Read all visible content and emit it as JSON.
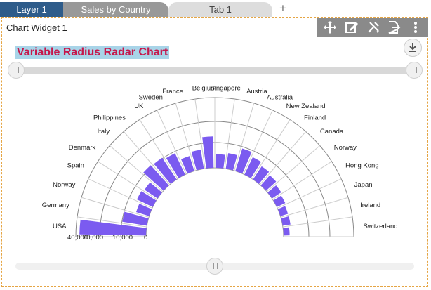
{
  "tabs": [
    {
      "label": "Layer 1"
    },
    {
      "label": "Sales by Country"
    },
    {
      "label": "Tab 1"
    }
  ],
  "add_tab_label": "+",
  "widget": {
    "title": "Chart Widget 1",
    "toolbar_icons": [
      "move-icon",
      "edit-icon",
      "tools-icon",
      "export-icon",
      "more-vertical-icon"
    ]
  },
  "chart_data": {
    "type": "bar",
    "subtype": "variable-radius-radar",
    "title": "Variable Radius Radar Chart",
    "categories": [
      "USA",
      "Germany",
      "Norway",
      "Spain",
      "Denmark",
      "Italy",
      "Philippines",
      "UK",
      "Sweden",
      "France",
      "Belgium",
      "Singapore",
      "Austria",
      "Australia",
      "New Zealand",
      "Finland",
      "Canada",
      "Norway",
      "Hong Kong",
      "Japan",
      "Ireland",
      "Switzerland"
    ],
    "values": [
      36000,
      5000,
      1500,
      2500,
      2000,
      6000,
      5500,
      4500,
      2000,
      3000,
      8000,
      1500,
      2000,
      4500,
      3000,
      2000,
      1500,
      1000,
      700,
      500,
      500,
      300
    ],
    "radial_axis_ticks": [
      "40,000",
      "20,000",
      "10,000",
      "0"
    ],
    "radial_axis_range": [
      0,
      40000
    ],
    "colors": {
      "bar": "#7b5bf0",
      "grid": "#cccccc",
      "title_bg": "#a8d4e8",
      "title_text": "#c5174b"
    }
  }
}
